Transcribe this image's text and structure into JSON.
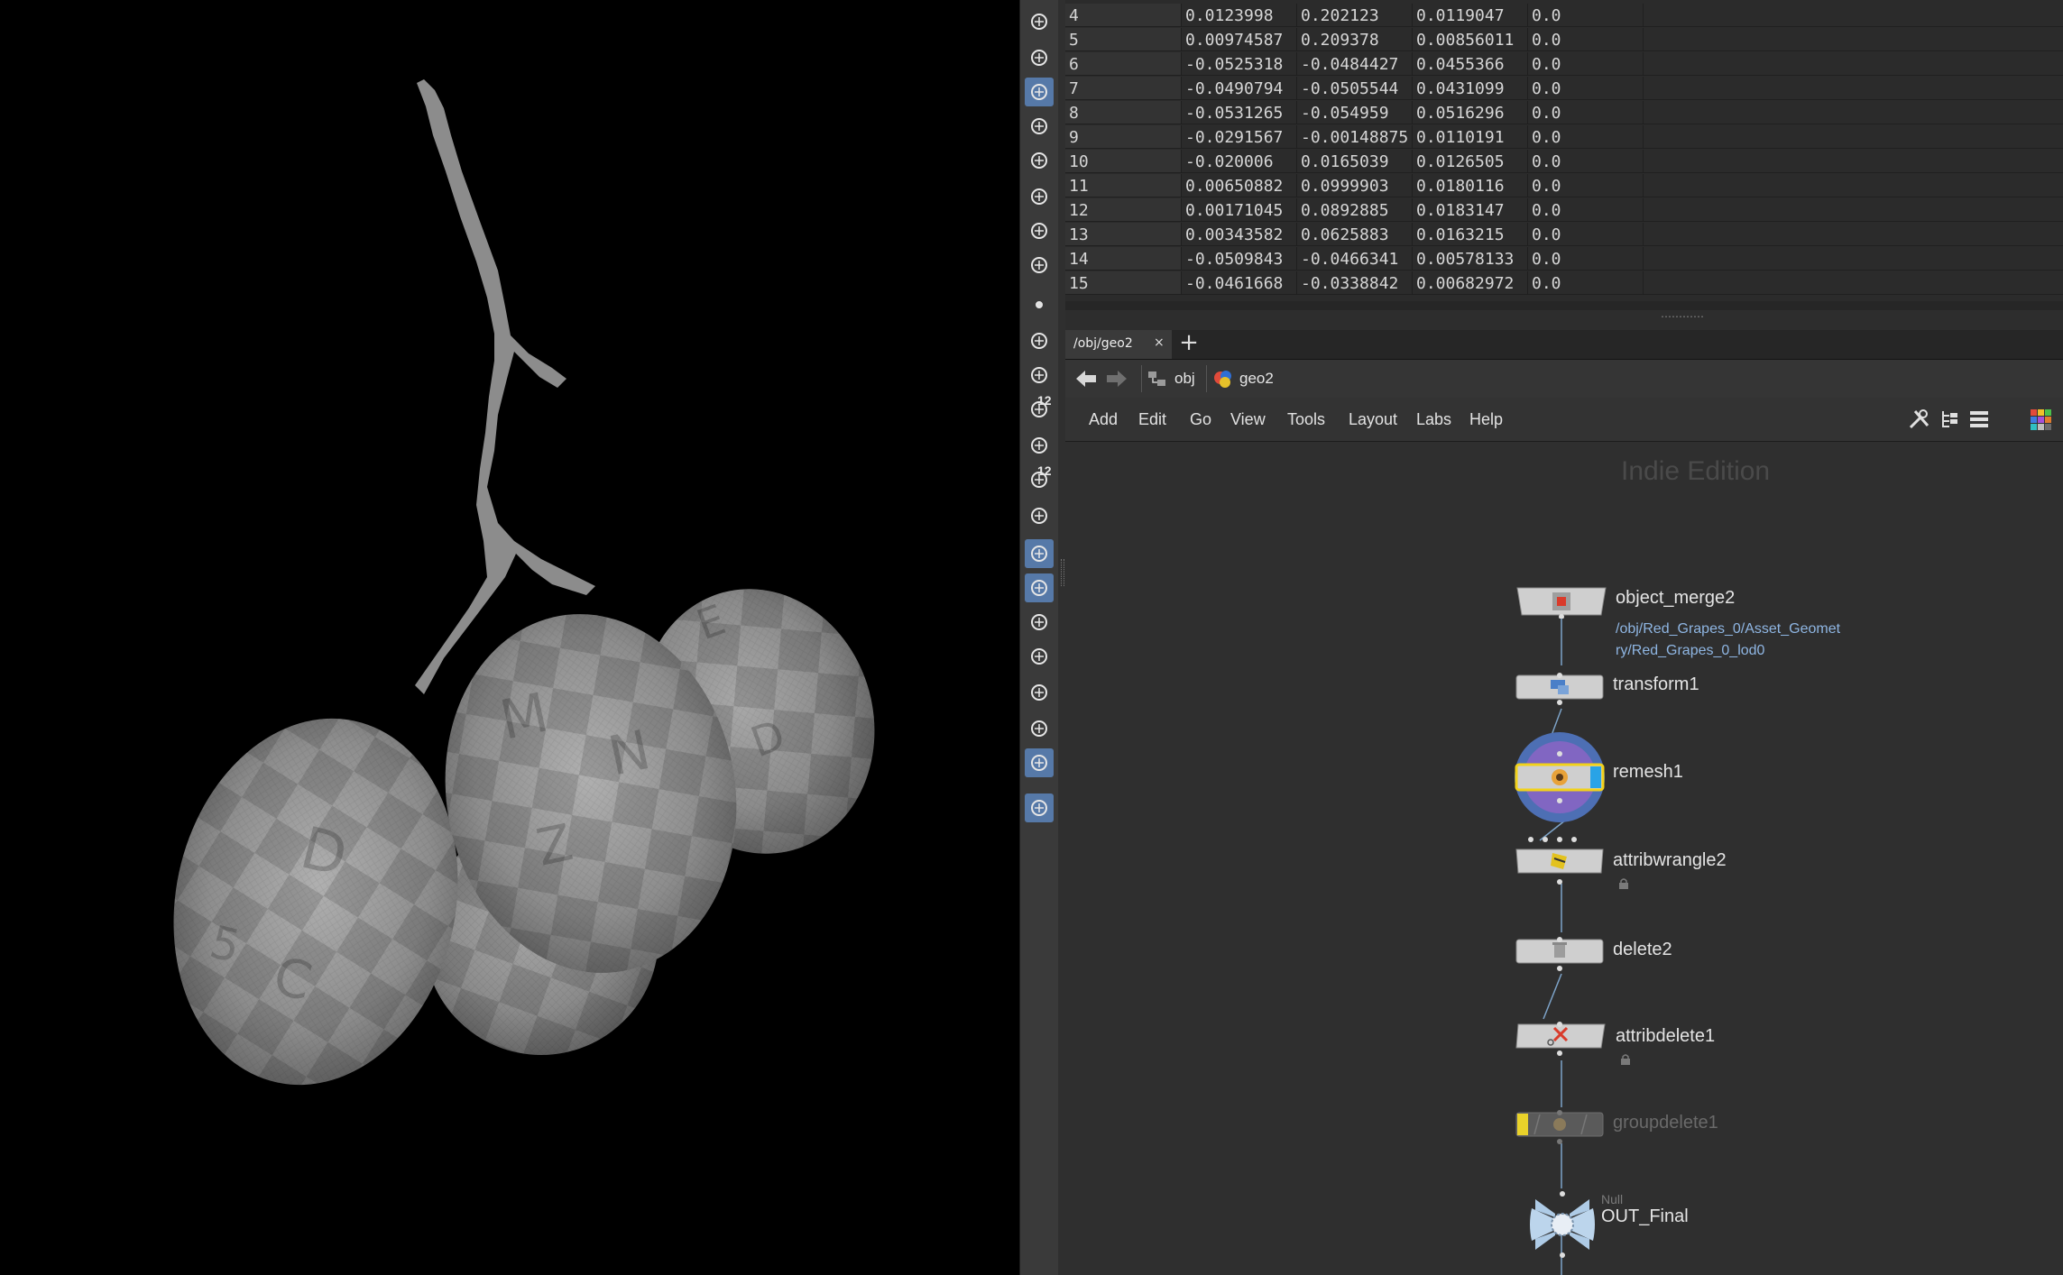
{
  "spreadsheet": {
    "rows": [
      {
        "index": "4",
        "c1": "0.0123998",
        "c2": "0.202123",
        "c3": "0.0119047",
        "c4": "0.0"
      },
      {
        "index": "5",
        "c1": "0.00974587",
        "c2": "0.209378",
        "c3": "0.00856011",
        "c4": "0.0"
      },
      {
        "index": "6",
        "c1": "-0.0525318",
        "c2": "-0.0484427",
        "c3": "0.0455366",
        "c4": "0.0"
      },
      {
        "index": "7",
        "c1": "-0.0490794",
        "c2": "-0.0505544",
        "c3": "0.0431099",
        "c4": "0.0"
      },
      {
        "index": "8",
        "c1": "-0.0531265",
        "c2": "-0.054959",
        "c3": "0.0516296",
        "c4": "0.0"
      },
      {
        "index": "9",
        "c1": "-0.0291567",
        "c2": "-0.00148875",
        "c3": "0.0110191",
        "c4": "0.0"
      },
      {
        "index": "10",
        "c1": "-0.020006",
        "c2": "0.0165039",
        "c3": "0.0126505",
        "c4": "0.0"
      },
      {
        "index": "11",
        "c1": "0.00650882",
        "c2": "0.0999903",
        "c3": "0.0180116",
        "c4": "0.0"
      },
      {
        "index": "12",
        "c1": "0.00171045",
        "c2": "0.0892885",
        "c3": "0.0183147",
        "c4": "0.0"
      },
      {
        "index": "13",
        "c1": "0.00343582",
        "c2": "0.0625883",
        "c3": "0.0163215",
        "c4": "0.0"
      },
      {
        "index": "14",
        "c1": "-0.0509843",
        "c2": "-0.0466341",
        "c3": "0.00578133",
        "c4": "0.0"
      },
      {
        "index": "15",
        "c1": "-0.0461668",
        "c2": "-0.0338842",
        "c3": "0.00682972",
        "c4": "0.0"
      }
    ]
  },
  "tabs": {
    "active_label": "/obj/geo2",
    "close_glyph": "×",
    "add_glyph": "+"
  },
  "path": {
    "crumbs": [
      {
        "label": "obj",
        "icon": "obj-network-icon"
      },
      {
        "label": "geo2",
        "icon": "geo-node-icon"
      }
    ]
  },
  "menu": {
    "items": [
      "Add",
      "Edit",
      "Go",
      "View",
      "Tools",
      "Layout",
      "Labs",
      "Help"
    ],
    "tools": [
      "wrench-icon",
      "tree-view-icon",
      "list-view-icon",
      "color-palette-icon"
    ]
  },
  "network": {
    "edition_label": "Indie Edition",
    "nodes": [
      {
        "name": "object_merge2",
        "subtext_line1": "/obj/Red_Grapes_0/Asset_Geomet",
        "subtext_line2": "ry/Red_Grapes_0_lod0"
      },
      {
        "name": "transform1"
      },
      {
        "name": "remesh1"
      },
      {
        "name": "attribwrangle2"
      },
      {
        "name": "delete2"
      },
      {
        "name": "attribdelete1"
      },
      {
        "name": "groupdelete1"
      },
      {
        "name": "OUT_Final",
        "type_label": "Null"
      }
    ],
    "colors": {
      "selected_outline": "#f2d21b",
      "display_flag": "#29a3e6",
      "bypass_flag": "#e9d22a",
      "wire": "#7da3c8"
    }
  },
  "shelf": {
    "tools": [
      "isolate-icon",
      "ghost-icon",
      "light-icon",
      "point-light-icon",
      "spot-light-icon",
      "group-light-icon",
      "camera-link-icon",
      "camera-icon",
      "dot-icon",
      "brush-icon",
      "pen-icon",
      "point-number-icon",
      "paint-icon",
      "primitive-number-icon",
      "axis-icon",
      "normals-icon",
      "checker-icon",
      "uv-icon",
      "uv-grid-icon",
      "pivot-icon",
      "shading-icon",
      "background-icon",
      "pin-icon"
    ],
    "badge_12": "12"
  }
}
